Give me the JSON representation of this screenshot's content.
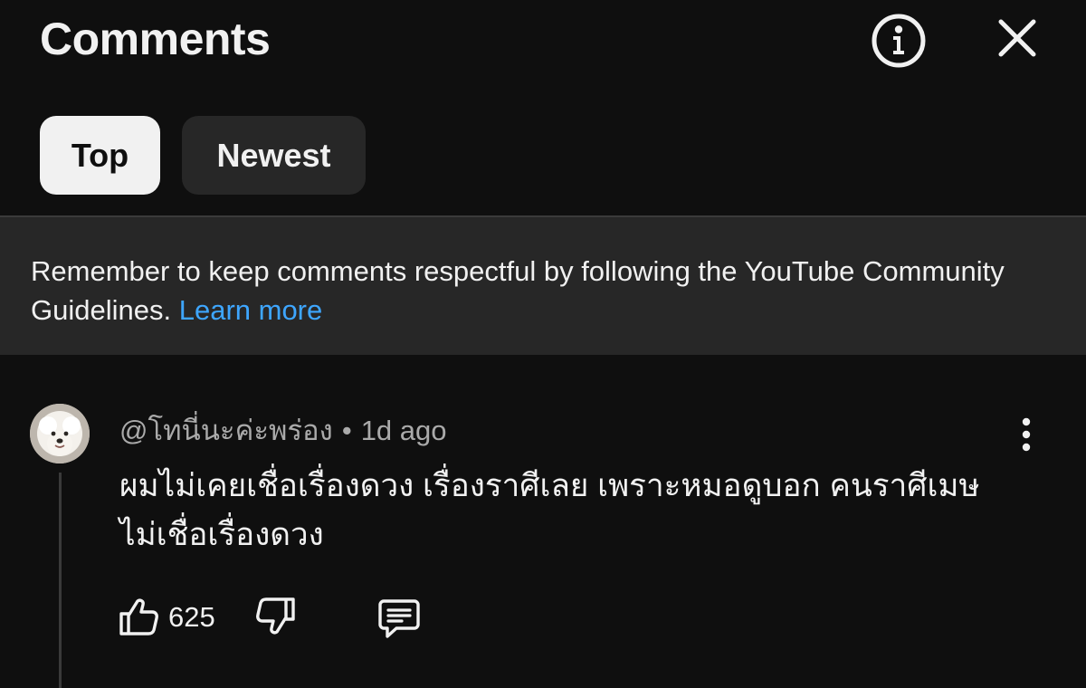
{
  "header": {
    "title": "Comments",
    "info_icon": "info-circle-icon",
    "close_icon": "close-icon"
  },
  "sort_chips": [
    {
      "label": "Top",
      "active": true
    },
    {
      "label": "Newest",
      "active": false
    }
  ],
  "notice": {
    "text": "Remember to keep comments respectful by following the YouTube Community Guidelines.",
    "link_text": "Learn more"
  },
  "comment": {
    "author": "@โทนี่นะค่ะพร่อง",
    "separator": "•",
    "time": "1d ago",
    "text": "ผมไม่เคยเชื่อเรื่องดวง เรื่องราศีเลย เพราะหมอดูบอก คนราศีเมษไม่เชื่อเรื่องดวง",
    "like_count": "625",
    "icons": {
      "like": "thumbs-up-icon",
      "dislike": "thumbs-down-icon",
      "reply": "reply-comment-icon",
      "menu": "more-vertical-icon",
      "avatar": "avatar"
    }
  },
  "colors": {
    "background": "#0f0f0f",
    "chip_active": "#f1f1f1",
    "chip_inactive": "#272727",
    "link": "#3ea6ff",
    "secondary_text": "#aaaaaa"
  }
}
